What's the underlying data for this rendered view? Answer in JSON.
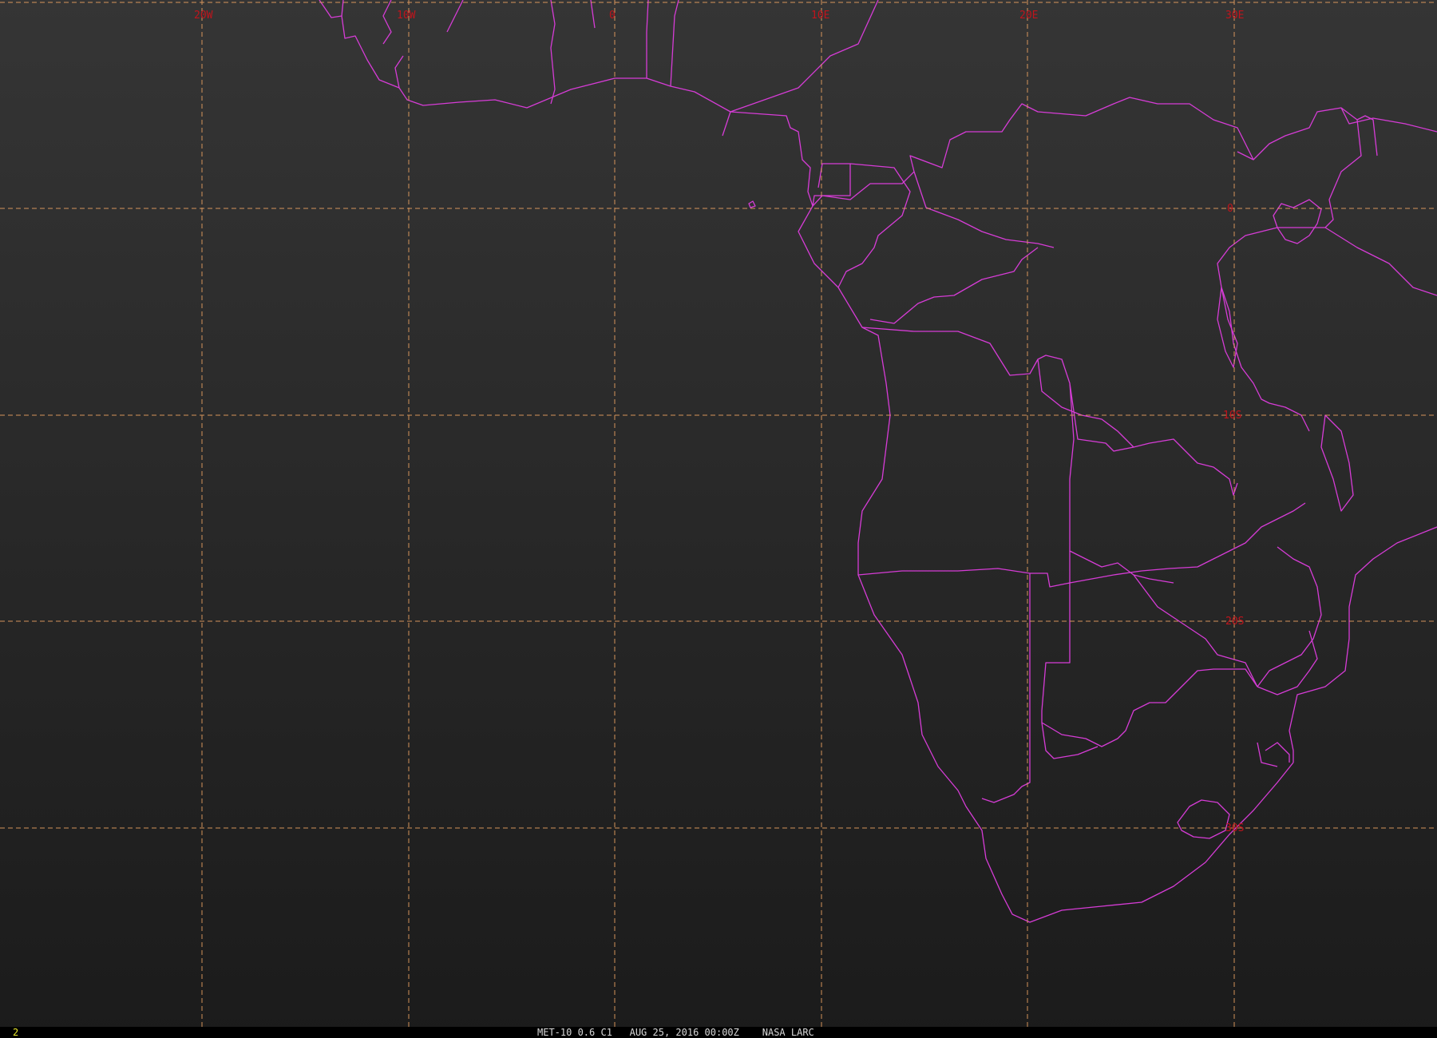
{
  "map": {
    "longitude_labels": [
      "20W",
      "10W",
      "0",
      "10E",
      "20E",
      "30E"
    ],
    "latitude_labels": [
      "0",
      "10S",
      "20S",
      "30S"
    ],
    "colors": {
      "background": "#2b2b2b",
      "coastline": "#d63cd6",
      "grid": "#e8a060",
      "grid_label": "#c0141c",
      "caption": "#d8d8d8",
      "frame_number": "#e7e72a"
    }
  },
  "status_bar": {
    "frame_number": "2",
    "caption": "MET-10 0.6 C1   AUG 25, 2016 00:00Z    NASA LARC"
  }
}
